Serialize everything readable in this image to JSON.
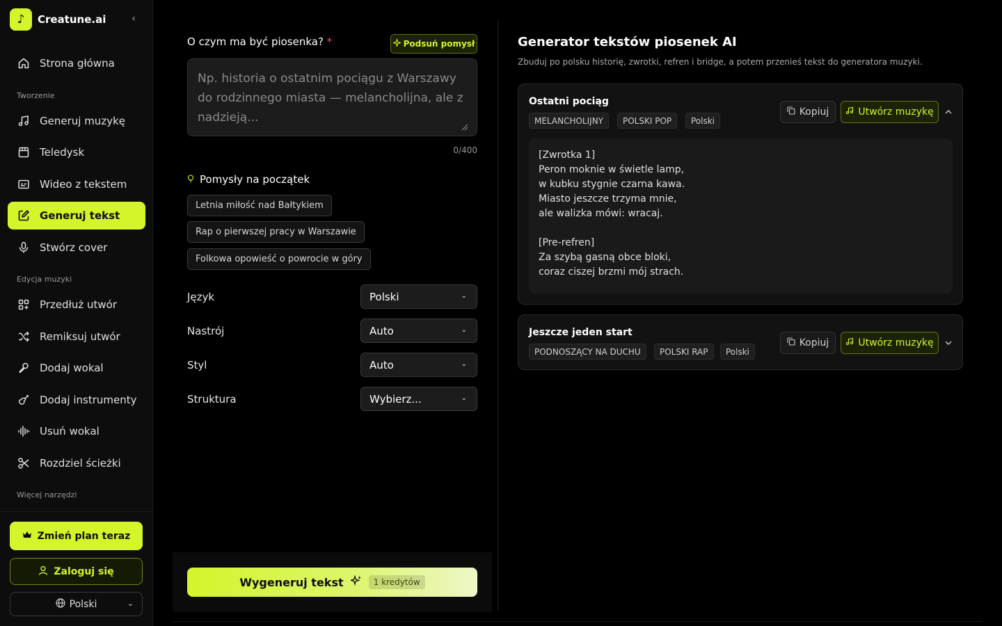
{
  "brand": {
    "name": "Creatune.ai",
    "logo_glyph": "♪"
  },
  "sidebar": {
    "home": "Strona główna",
    "section_create": "Tworzenie",
    "create_items": [
      "Generuj muzykę",
      "Teledysk",
      "Wideo z tekstem",
      "Generuj tekst",
      "Stwórz cover"
    ],
    "section_edit": "Edycja muzyki",
    "edit_items": [
      "Przedłuż utwór",
      "Remiksuj utwór",
      "Dodaj wokal",
      "Dodaj instrumenty",
      "Usuń wokal",
      "Rozdziel ścieżki"
    ],
    "section_more": "Więcej narzędzi",
    "upgrade_label": "Zmień plan teraz",
    "login_label": "Zaloguj się",
    "language_label": "Polski"
  },
  "form": {
    "topic_label": "O czym ma być piosenka?",
    "required_mark": "*",
    "suggest_label": "Podsuń pomysł",
    "topic_placeholder": "Np. historia o ostatnim pociągu z Warszawy do rodzinnego miasta — melancholijna, ale z nadzieją...",
    "topic_value": "",
    "char_count": "0/400",
    "ideas_title": "Pomysły na początek",
    "ideas": [
      "Letnia miłość nad Bałtykiem",
      "Rap o pierwszej pracy w Warszawie",
      "Folkowa opowieść o powrocie w góry"
    ],
    "fields": [
      {
        "label": "Język",
        "value": "Polski"
      },
      {
        "label": "Nastrój",
        "value": "Auto"
      },
      {
        "label": "Styl",
        "value": "Auto"
      },
      {
        "label": "Struktura",
        "value": "Wybierz..."
      }
    ],
    "generate_label": "Wygeneruj tekst",
    "credits": "1 kredytów"
  },
  "results": {
    "title": "Generator tekstów piosenek AI",
    "subtitle": "Zbuduj po polsku historię, zwrotki, refren i bridge, a potem przenieś tekst do generatora muzyki.",
    "copy_label": "Kopiuj",
    "create_music_label": "Utwórz muzykę",
    "cards": [
      {
        "title": "Ostatni pociąg",
        "tags": [
          "MELANCHOLIJNY",
          "POLSKI POP",
          "Polski"
        ],
        "expanded": true,
        "lyrics": [
          "[Zwrotka 1]",
          "Peron moknie w świetle lamp,",
          "w kubku stygnie czarna kawa.",
          "Miasto jeszcze trzyma mnie,",
          "ale walizka mówi: wracaj.",
          "",
          "[Pre-refren]",
          "Za szybą gasną obce bloki,",
          "coraz ciszej brzmi mój strach."
        ]
      },
      {
        "title": "Jeszcze jeden start",
        "tags": [
          "PODNOSZĄCY NA DUCHU",
          "POLSKI RAP",
          "Polski"
        ],
        "expanded": false
      }
    ]
  },
  "colors": {
    "accent": "#d4f52a",
    "background": "#000000",
    "sidebar": "#0d0d0d",
    "required": "#ff4d4d"
  }
}
